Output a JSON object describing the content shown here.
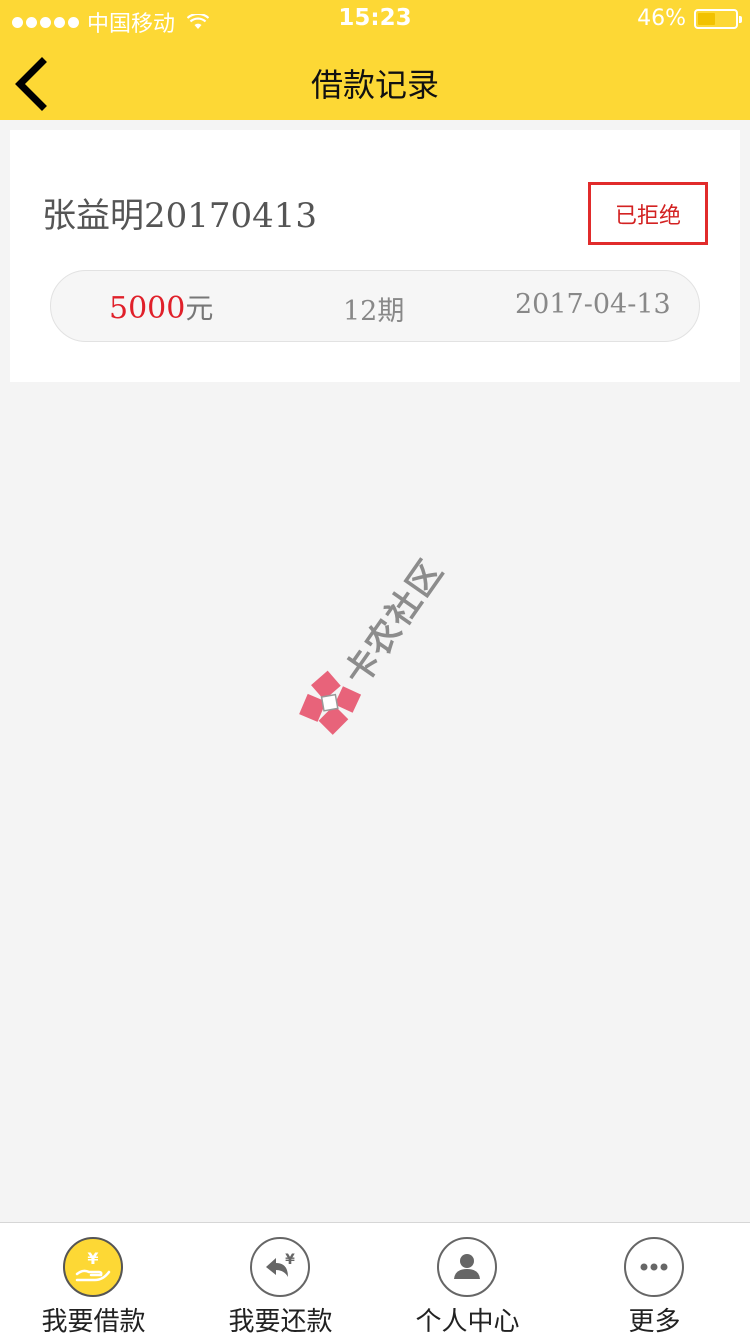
{
  "status_bar": {
    "carrier": "中国移动",
    "time": "15:23",
    "battery_percent": "46%",
    "battery_level": 0.46
  },
  "nav": {
    "title": "借款记录",
    "back_icon": "chevron-left-icon"
  },
  "record": {
    "name": "张益明20170413",
    "status": "已拒绝",
    "amount": "5000",
    "amount_unit": "元",
    "period": "12期",
    "date": "2017-04-13"
  },
  "watermark": {
    "text": "卡农社区"
  },
  "tabbar": {
    "tabs": [
      {
        "label": "我要借款",
        "icon": "loan-hand-yen-icon",
        "active": true
      },
      {
        "label": "我要还款",
        "icon": "repay-arrow-yen-icon",
        "active": false
      },
      {
        "label": "个人中心",
        "icon": "user-icon",
        "active": false
      },
      {
        "label": "更多",
        "icon": "more-dots-icon",
        "active": false
      }
    ]
  },
  "colors": {
    "brand_yellow": "#fdd835",
    "status_red": "#e12b2b",
    "amount_red": "#e0202a",
    "page_bg": "#f4f4f4"
  }
}
